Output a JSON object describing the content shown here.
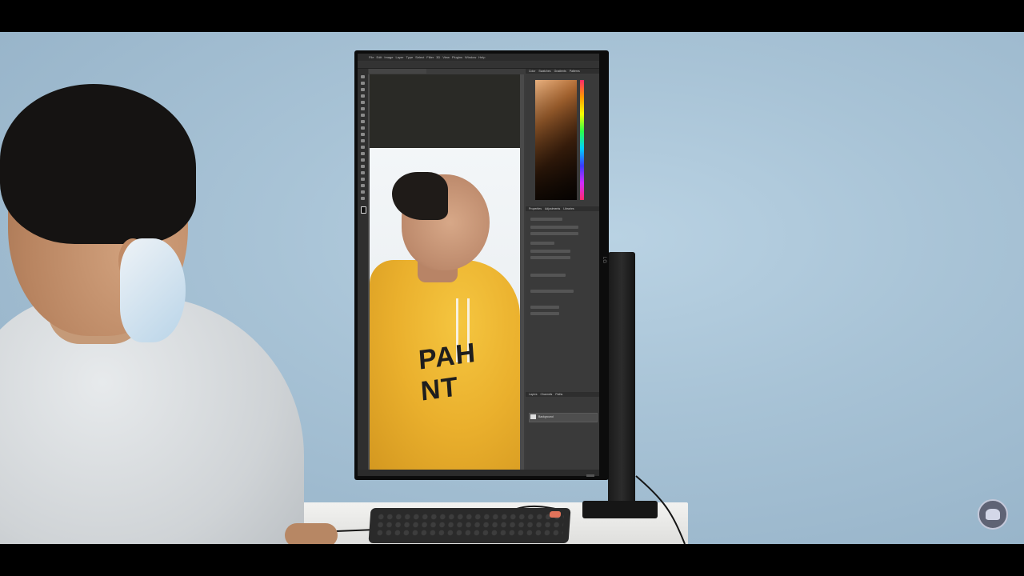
{
  "scene": {
    "description_tags": [
      "person-with-mask",
      "vertical-monitor",
      "photo-editor",
      "keyboard",
      "desk"
    ]
  },
  "editor": {
    "menu_items": [
      "File",
      "Edit",
      "Image",
      "Layer",
      "Type",
      "Select",
      "Filter",
      "3D",
      "View",
      "Plugins",
      "Window",
      "Help"
    ],
    "panel_tabs_top": [
      "Color",
      "Swatches",
      "Gradients",
      "Patterns"
    ],
    "panel_tabs_props": [
      "Properties",
      "Adjustments",
      "Libraries"
    ],
    "panel_tabs_layers": [
      "Layers",
      "Channels",
      "Paths"
    ],
    "layer_name": "Background",
    "colors": {
      "ui_dark": "#3c3c3c",
      "hoodie": "#eab02d"
    }
  },
  "photo": {
    "shirt_text": "PAH NT"
  },
  "monitor": {
    "brand": "LG"
  }
}
